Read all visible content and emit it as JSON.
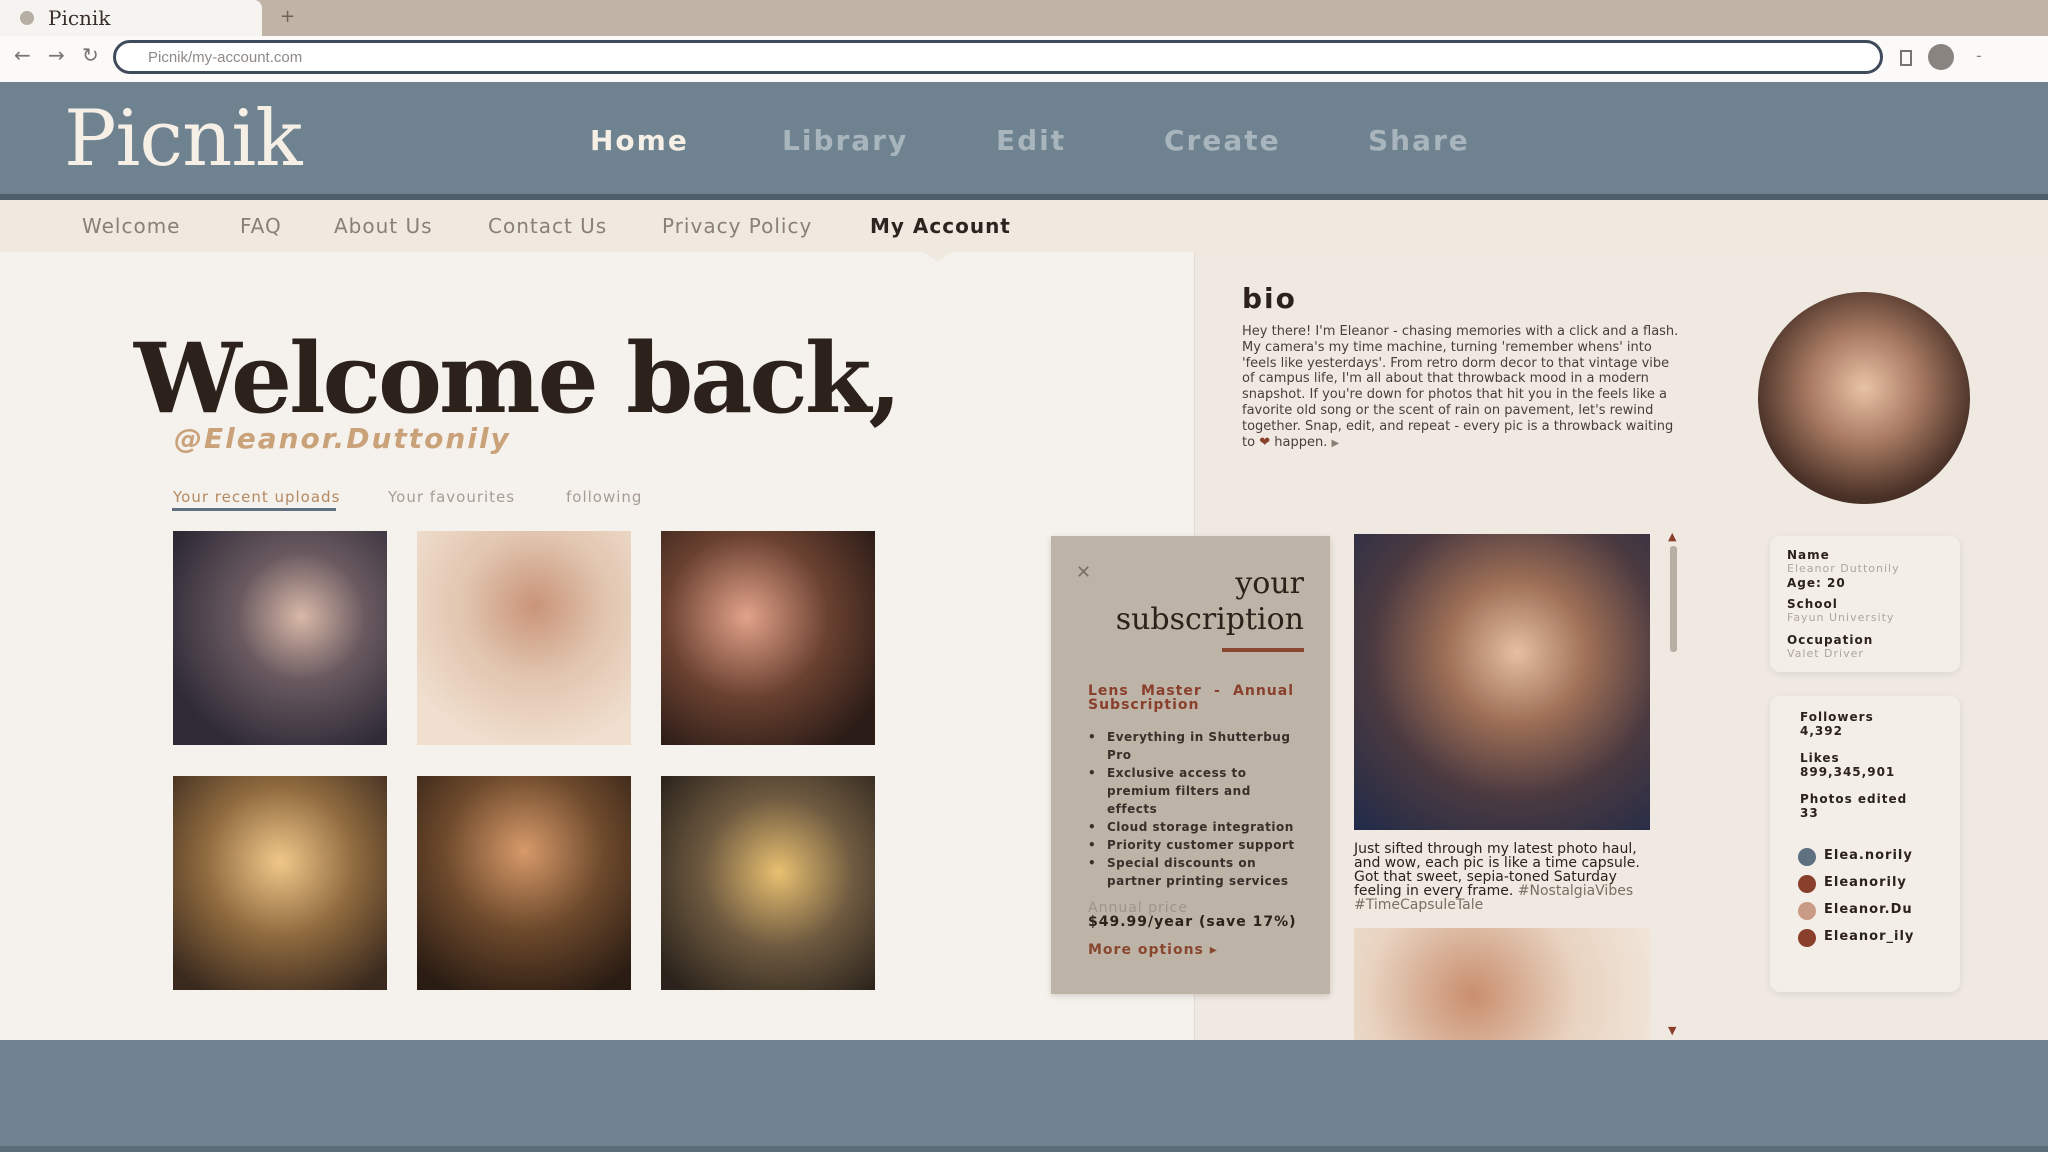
{
  "browser": {
    "tab_title": "Picnik",
    "new_tab": "+",
    "address": "Picnik/my-account.com"
  },
  "site": {
    "logo": "Picnik",
    "main_nav": [
      "Home",
      "Library",
      "Edit",
      "Create",
      "Share"
    ],
    "main_nav_active": "Home",
    "sub_nav": [
      "Welcome",
      "FAQ",
      "About Us",
      "Contact Us",
      "Privacy Policy",
      "My Account"
    ],
    "sub_nav_active": "My Account"
  },
  "welcome": {
    "title": "Welcome back,",
    "handle": "@Eleanor.Duttonily",
    "tabs": [
      "Your recent uploads",
      "Your favourites",
      "following"
    ],
    "active_tab": "Your recent uploads"
  },
  "subscription": {
    "close": "✕",
    "title_line1": "your",
    "title_line2": "subscription",
    "plan": "Lens Master - Annual Subscription",
    "features": [
      "Everything in Shutterbug Pro",
      "Exclusive access to premium filters and effects",
      "Cloud storage integration",
      "Priority customer support",
      "Special discounts on partner printing services"
    ],
    "price_label": "Annual price",
    "price": "$49.99/year (save 17%)",
    "more": "More options ▸"
  },
  "bio": {
    "title": "bio",
    "text": "Hey there! I'm Eleanor - chasing memories with a click and a flash. My camera's my time machine, turning 'remember whens' into 'feels like yesterdays'. From retro dorm decor to that vintage vibe of campus life, I'm all about that throwback mood in a modern snapshot. If you're down for photos that hit you in the feels like a favorite old song or the scent of rain on pavement, let's rewind together. Snap, edit, and repeat - every pic is a throwback waiting to",
    "heart": "❤",
    "text_end": "happen.",
    "more_arrow": "▶"
  },
  "profile": {
    "name_label": "Name",
    "name": "Eleanor Duttonily",
    "age": "Age: 20",
    "school_label": "School",
    "school": "Fayun University",
    "occupation_label": "Occupation",
    "occupation": "Valet Driver"
  },
  "stats": {
    "followers_label": "Followers",
    "followers": "4,392",
    "likes_label": "Likes",
    "likes": "899,345,901",
    "edited_label": "Photos edited",
    "edited": "33",
    "socials": [
      {
        "icon": "tiktok-icon",
        "handle": "Elea.norily",
        "color": "#5f7080"
      },
      {
        "icon": "youtube-icon",
        "handle": "Eleanorily",
        "color": "#8a3f2c"
      },
      {
        "icon": "instagram-icon",
        "handle": "Eleanor.Du",
        "color": "#c99a85"
      },
      {
        "icon": "pinterest-icon",
        "handle": "Eleanor_ily",
        "color": "#8a3f2c"
      }
    ]
  },
  "feed": {
    "caption": "Just sifted through my latest photo haul, and wow, each pic is like a time capsule. Got that sweet, sepia-toned Saturday feeling in every frame.",
    "tags": "#NostalgiaVibes #TimeCapsuleTale",
    "scroll_up": "▲",
    "scroll_down": "▼"
  },
  "colors": {
    "header": "#6f8290",
    "accent": "#8a4730",
    "handle": "#c9a27a",
    "text_dark": "#2c211b"
  }
}
